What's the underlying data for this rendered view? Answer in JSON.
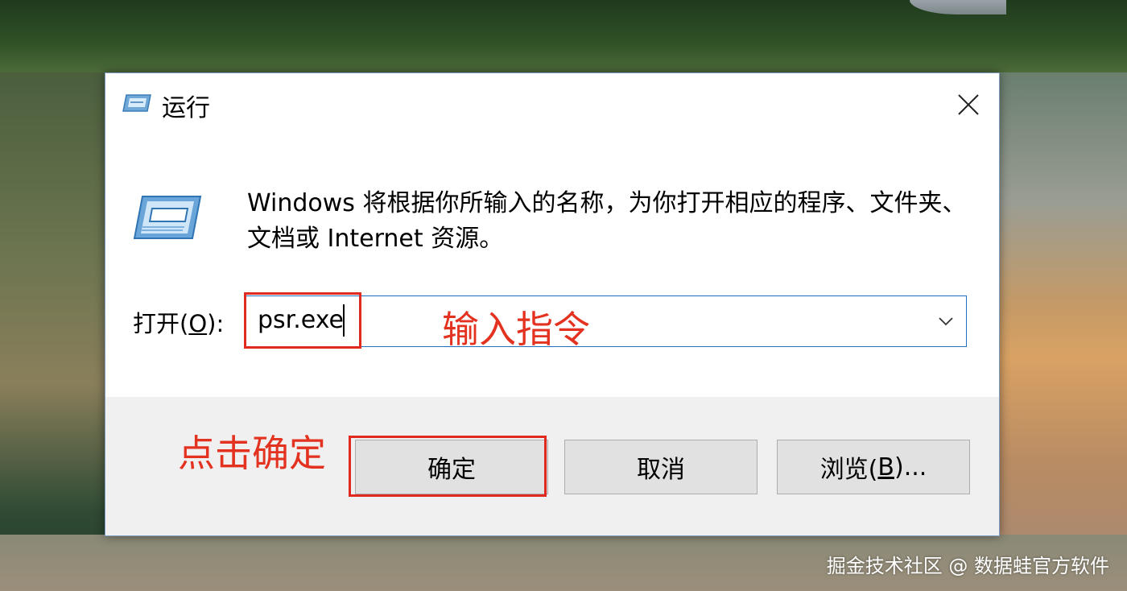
{
  "dialog": {
    "title": "运行",
    "close_glyph": "✕",
    "description": "Windows 将根据你所输入的名称，为你打开相应的程序、文件夹、文档或 Internet 资源。",
    "open_label_prefix": "打开(",
    "open_label_accesskey": "O",
    "open_label_suffix": "):",
    "command_value": "psr.exe",
    "buttons": {
      "ok": "确定",
      "cancel": "取消",
      "browse_prefix": "浏览(",
      "browse_accesskey": "B",
      "browse_suffix": ")..."
    }
  },
  "annotations": {
    "input_hint": "输入指令",
    "click_hint": "点击确定",
    "color": "#e02a1f"
  },
  "watermark": "掘金技术社区 @ 数据蛙官方软件",
  "icons": {
    "title": "run-dialog-icon",
    "main": "run-program-icon",
    "close": "close-icon",
    "dropdown": "chevron-down-icon"
  },
  "colors": {
    "focus_border": "#1e6fbf",
    "button_bg": "#e1e1e1",
    "footer_bg": "#f0f0f0"
  }
}
